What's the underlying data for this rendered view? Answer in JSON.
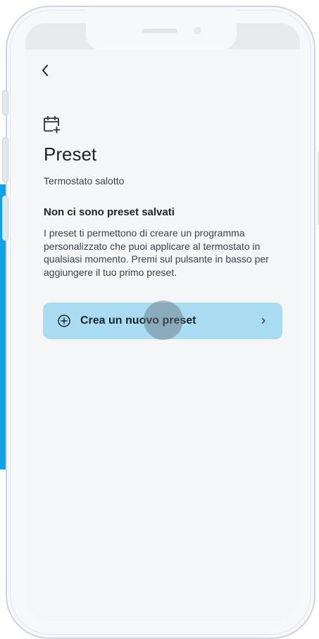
{
  "header": {
    "back_glyph": "‹",
    "title": "Preset",
    "subtitle": "Termostato salotto"
  },
  "empty_state": {
    "heading": "Non ci sono preset salvati",
    "body": "I preset ti permettono di creare un programma personalizzato che puoi applicare al termostato in qualsiasi momento. Premi sul pulsante in basso per aggiungere il tuo primo preset."
  },
  "create_button": {
    "label": "Crea un nuovo preset",
    "chevron": "›"
  },
  "icons": {
    "back": "chevron-left-icon",
    "header": "calendar-plus-icon",
    "button": "plus-circle-icon",
    "trailing": "chevron-right-icon"
  },
  "colors": {
    "button_bg": "#a9dcf3",
    "accent_blue": "#0ea3e6",
    "text": "#1d2226",
    "screen_bg": "#f5f6f7"
  }
}
